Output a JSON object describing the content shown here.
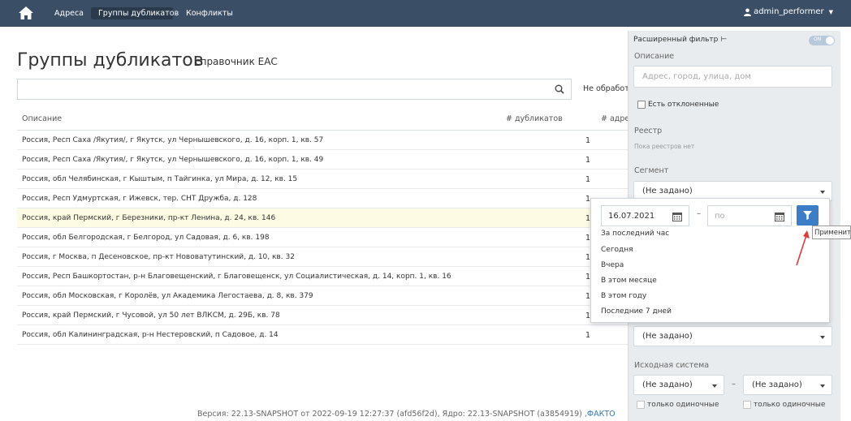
{
  "navbar": {
    "links": [
      "Адреса",
      "Группы дубликатов",
      "Конфликты"
    ],
    "user": "admin_performer"
  },
  "page": {
    "title": "Группы дубликатов",
    "subtitle": "справочник ЕАС"
  },
  "search": {
    "value": "",
    "status_filter": "Не обработа"
  },
  "table": {
    "columns": [
      "Описание",
      "# дубликатов",
      "# адре"
    ],
    "rows": [
      {
        "description": "Россия, Респ Саха /Якутия/, г Якутск, ул Чернышевского, д. 16, корп. 1, кв. 57",
        "count": "1"
      },
      {
        "description": "Россия, Респ Саха /Якутия/, г Якутск, ул Чернышевского, д. 16, корп. 1, кв. 49",
        "count": "1"
      },
      {
        "description": "Россия, обл Челябинская, г Кыштым, п Тайгинка, ул Мира, д. 12, кв. 15",
        "count": "1"
      },
      {
        "description": "Россия, Респ Удмуртская, г Ижевск, тер. СНТ Дружба, д. 128",
        "count": "1"
      },
      {
        "description": "Россия, край Пермский, г Березники, пр-кт Ленина, д. 24, кв. 146",
        "count": "1"
      },
      {
        "description": "Россия, обл Белгородская, г Белгород, ул Садовая, д. 6, кв. 198",
        "count": "1"
      },
      {
        "description": "Россия, г Москва, п Десеновское, пр-кт Нововатутинский, д. 10, кв. 32",
        "count": "1"
      },
      {
        "description": "Россия, Респ Башкортостан, р-н Благовещенский, г Благовещенск, ул Социалистическая, д. 14, корп. 1, кв. 16",
        "count": "1"
      },
      {
        "description": "Россия, обл Московская, г Королёв, ул Академика Легостаева, д. 8, кв. 379",
        "count": "1"
      },
      {
        "description": "Россия, край Пермский, г Чусовой, ул 50 лет ВЛКСМ, д. 29Б, кв. 78",
        "count": "1"
      },
      {
        "description": "Россия, обл Калининградская, р-н Нестеровский, п Садовое, д. 14",
        "count": "1"
      }
    ]
  },
  "footer": {
    "text": "Версия: 22.13-SNAPSHOT от 2022-09-19 12:27:37 (afd56f2d), Ядро: 22.13-SNAPSHOT (a3854919) ,",
    "link": "ФАКТО"
  },
  "filter_panel": {
    "title": "Расширенный фильтр",
    "toggle": "ON",
    "description_label": "Описание",
    "description_placeholder": "Адрес, город, улица, дом",
    "rejected_label": "Есть отклоненные",
    "registry_label": "Реестр",
    "registry_empty": "Пока реестров нет",
    "segment_label": "Сегмент",
    "segment_value": "(Не задано)",
    "select4_value": "(Не задано)",
    "source_label": "Исходная система",
    "source_from": "(Не задано)",
    "source_to": "(Не задано)",
    "single_only_1": "только одиночные",
    "single_only_2": "только одиночные"
  },
  "date_popup": {
    "from": "16.07.2021",
    "to_placeholder": "по",
    "presets": [
      "За последний час",
      "Сегодня",
      "Вчера",
      "В этом месяце",
      "В этом году",
      "Последние 7 дней"
    ]
  },
  "tooltip": "Применить",
  "colors": {
    "navbar": "#3a4f66",
    "panel": "#e9ecef",
    "highlight_row": "#fdfbe3",
    "apply_button": "#3c7dc7",
    "annotation": "#e53935"
  }
}
